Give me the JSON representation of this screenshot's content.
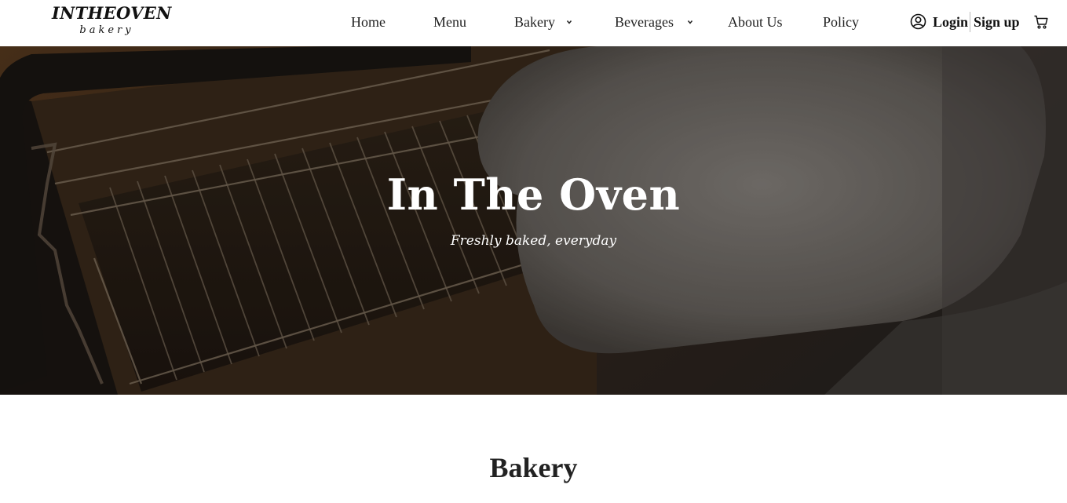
{
  "logo": {
    "main": "INTHEOVEN",
    "sub": "bakery"
  },
  "nav": {
    "items": [
      {
        "label": "Home"
      },
      {
        "label": "Menu"
      },
      {
        "label": "Bakery",
        "has_dropdown": true
      },
      {
        "label": "Beverages",
        "has_dropdown": true
      },
      {
        "label": "About Us"
      },
      {
        "label": "Policy"
      }
    ]
  },
  "auth": {
    "login": "Login",
    "signup": "Sign up"
  },
  "icons": {
    "user": "user-circle-icon",
    "cart": "cart-icon",
    "dropdown": "chevron-down-icon"
  },
  "hero": {
    "title": "In The Oven",
    "subtitle": "Freshly baked, everyday"
  },
  "section": {
    "title": "Bakery"
  },
  "colors": {
    "text": "#222222",
    "hero_overlay": "#1e1712",
    "white": "#ffffff"
  }
}
